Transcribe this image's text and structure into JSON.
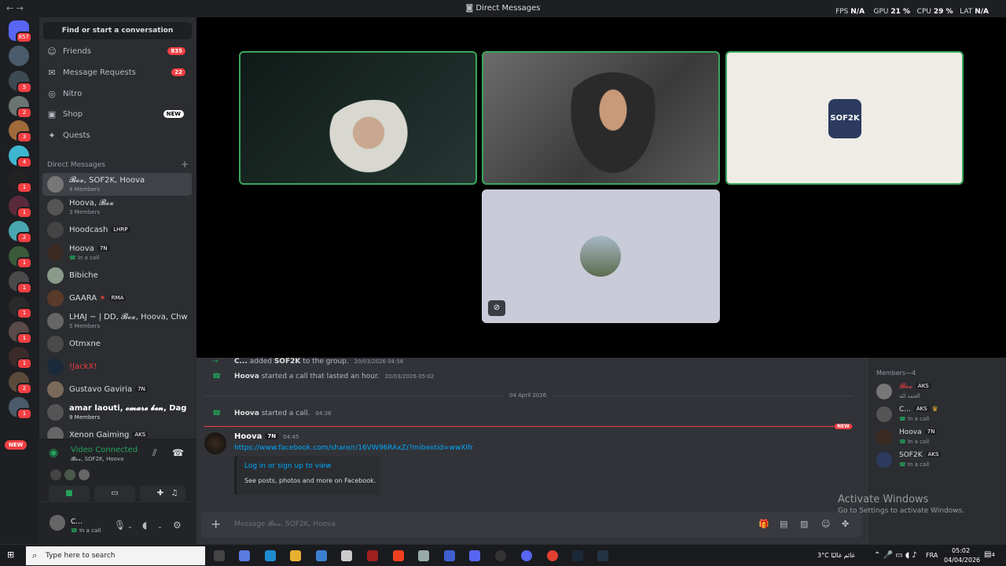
{
  "window": {
    "title": "Direct Messages",
    "stats": {
      "fps_label": "FPS",
      "fps": "N/A",
      "gpu_label": "GPU",
      "gpu": "21 %",
      "cpu_label": "CPU",
      "cpu": "29 %",
      "lat_label": "LAT",
      "lat": "N/A"
    }
  },
  "servers": {
    "home_badge": "857",
    "badges": [
      "5",
      "2",
      "3",
      "4",
      "1",
      "1",
      "2",
      "1",
      "1",
      "1",
      "1",
      "1",
      "1",
      "2",
      "1"
    ],
    "new_label": "NEW"
  },
  "sidebar": {
    "find_label": "Find or start a conversation",
    "nav": [
      {
        "label": "Friends",
        "count": "835"
      },
      {
        "label": "Message Requests",
        "count": "22"
      },
      {
        "label": "Nitro"
      },
      {
        "label": "Shop",
        "new": "NEW"
      },
      {
        "label": "Quests"
      }
    ],
    "dm_header": "Direct Messages",
    "dms": [
      {
        "name": "𝓑𝓸𝔁, SOF2K, Hoova",
        "sub": "4 Members"
      },
      {
        "name": "Hoova, 𝓑𝓸𝔁",
        "sub": "3 Members"
      },
      {
        "name": "Hoodcash",
        "tag": "LHRP"
      },
      {
        "name": "Hoova",
        "tag": "7N",
        "sub": "In a call"
      },
      {
        "name": "Bibiche"
      },
      {
        "name": "GAARA",
        "tag": "RMA"
      },
      {
        "name": "LHAJ ~ | DD, 𝓑𝓸𝔁, Hoova, Chwi...",
        "sub": "5 Members"
      },
      {
        "name": "Otmxne"
      },
      {
        "name": "!JackX!"
      },
      {
        "name": "Gustavo Gaviria",
        "tag": "7N"
      },
      {
        "name": "amar laouti, 𝓸𝓶𝓪𝓻𝓮 𝓫𝓮𝓷, DagLa...",
        "sub": "9 Members"
      },
      {
        "name": "Xenon Gaiming",
        "tag": "AKS"
      }
    ],
    "voice": {
      "title": "Video Connected",
      "sub": "𝓑𝓸𝔁, SOF2K, Hoova"
    },
    "user": {
      "name": "C...",
      "status": "In a call"
    }
  },
  "stage": {
    "tile3_label": "SOF2K"
  },
  "chat": {
    "system": [
      {
        "author": "C...",
        "text1": "added",
        "target": "SOF2K",
        "text2": "to the group.",
        "time": "20/03/2026 04:56"
      },
      {
        "author": "Hoova",
        "text1": "started a call that lasted an hour.",
        "time": "20/03/2026 05:02"
      },
      {
        "author": "Hoova",
        "text1": "started a call.",
        "time": "04:36"
      }
    ],
    "date_divider": "04 April 2026",
    "new_tag": "NEW",
    "message": {
      "author": "Hoova",
      "tag": "7N",
      "time": "04:45",
      "link": "https://www.facebook.com/share/r/16VW96RAxZ/?mibextid=wwXIfr",
      "embed_title": "Log in or sign up to view",
      "embed_desc": "See posts, photos and more on Facebook."
    },
    "composer_placeholder": "Message 𝓑𝓸𝔁, SOF2K, Hoova"
  },
  "members": {
    "header": "Members—4",
    "list": [
      {
        "name": "𝓑𝓸𝔁",
        "tag": "AKS",
        "status": "الحمد لله"
      },
      {
        "name": "C...",
        "tag": "AKS",
        "status": "In a call"
      },
      {
        "name": "Hoova",
        "tag": "7N",
        "status": "In a call"
      },
      {
        "name": "SOF2K",
        "tag": "AKS",
        "status": "In a call"
      }
    ]
  },
  "watermark": {
    "line1": "Activate Windows",
    "line2": "Go to Settings to activate Windows."
  },
  "taskbar": {
    "search_placeholder": "Type here to search",
    "weather": "3°C  غائم غالبًا",
    "lang": "FRA",
    "time": "05:02",
    "date": "04/04/2026",
    "notif": "4"
  },
  "colors": {
    "accent": "#5865f2",
    "green": "#23a55a",
    "red": "#f23f43",
    "link": "#00a8fc"
  }
}
